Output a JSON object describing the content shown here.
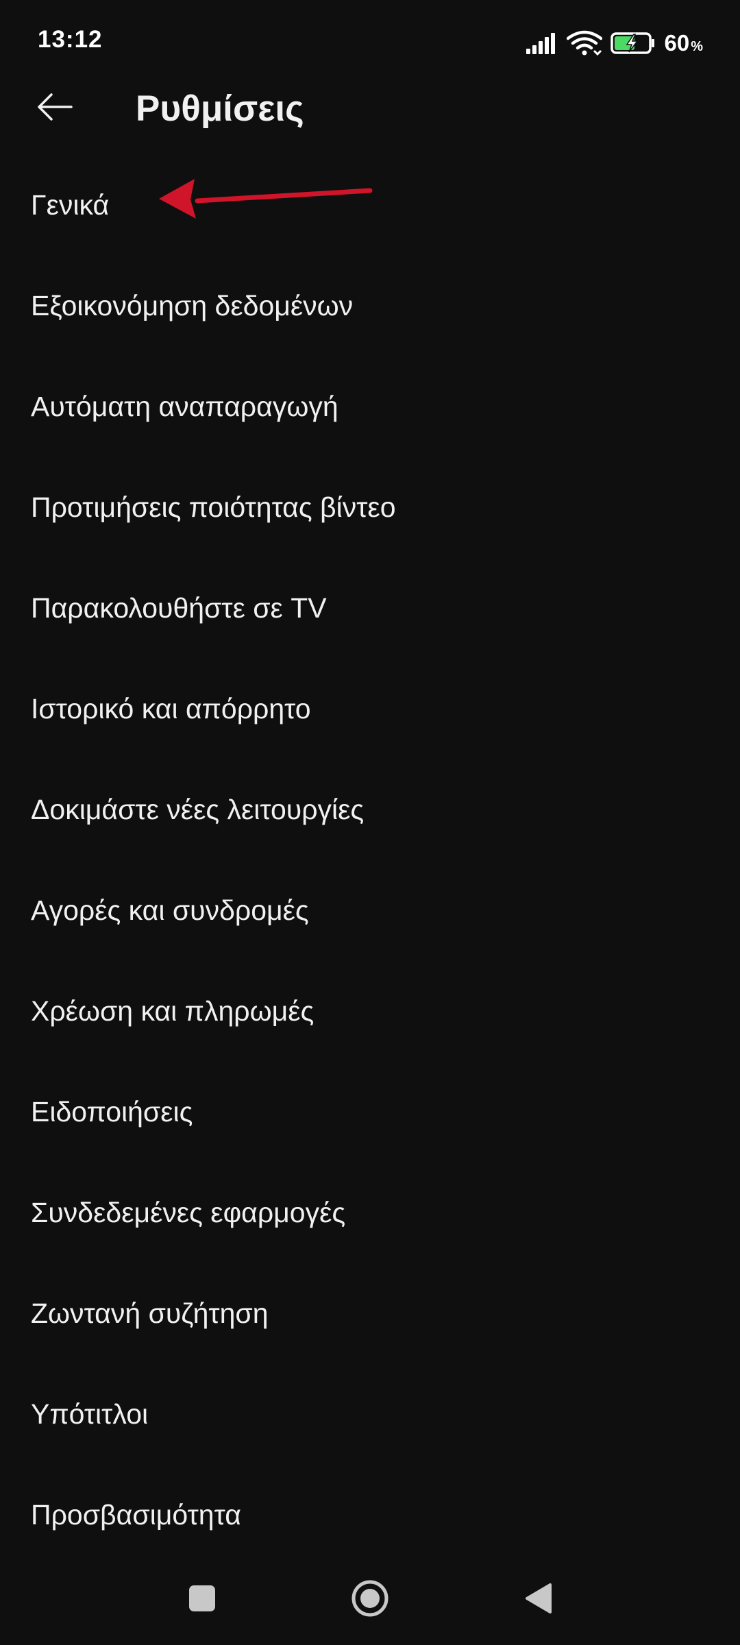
{
  "status_bar": {
    "time": "13:12",
    "battery_value": "60",
    "battery_unit": "%",
    "battery_level": 0.6,
    "charging_color": "#4cd964"
  },
  "header": {
    "back_icon": "arrow-left-icon",
    "title": "Ρυθμίσεις"
  },
  "settings": {
    "items": [
      {
        "label": "Γενικά"
      },
      {
        "label": "Εξοικονόμηση δεδομένων"
      },
      {
        "label": "Αυτόματη αναπαραγωγή"
      },
      {
        "label": "Προτιμήσεις ποιότητας βίντεο"
      },
      {
        "label": "Παρακολουθήστε σε TV"
      },
      {
        "label": "Ιστορικό και απόρρητο"
      },
      {
        "label": "Δοκιμάστε νέες λειτουργίες"
      },
      {
        "label": "Αγορές και συνδρομές"
      },
      {
        "label": "Χρέωση και πληρωμές"
      },
      {
        "label": "Ειδοποιήσεις"
      },
      {
        "label": "Συνδεδεμένες εφαρμογές"
      },
      {
        "label": "Ζωντανή συζήτηση"
      },
      {
        "label": "Υπότιτλοι"
      },
      {
        "label": "Προσβασιμότητα"
      }
    ]
  },
  "annotation": {
    "arrow_color": "#d0142a",
    "points_to": "Γενικά"
  },
  "nav_bar": {
    "icons": [
      "recent-apps-icon",
      "home-icon",
      "back-triangle-icon"
    ]
  },
  "colors": {
    "background": "#0f0f0f",
    "text": "#f1f1f1"
  }
}
